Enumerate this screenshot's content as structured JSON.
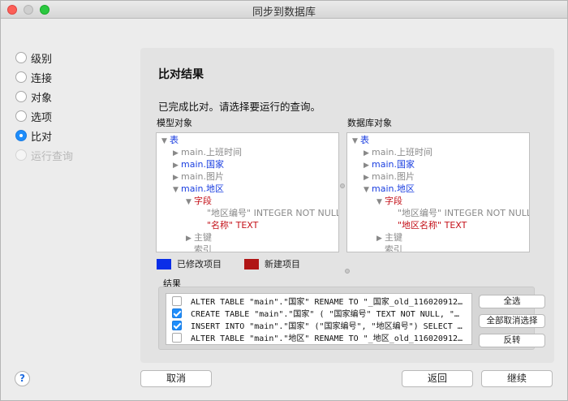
{
  "window": {
    "title": "同步到数据库"
  },
  "steps": [
    {
      "label": "级别",
      "selected": false,
      "disabled": false
    },
    {
      "label": "连接",
      "selected": false,
      "disabled": false
    },
    {
      "label": "对象",
      "selected": false,
      "disabled": false
    },
    {
      "label": "选项",
      "selected": false,
      "disabled": false
    },
    {
      "label": "比对",
      "selected": true,
      "disabled": false
    },
    {
      "label": "运行查询",
      "selected": false,
      "disabled": true
    }
  ],
  "panel": {
    "title": "比对结果",
    "description": "已完成比对。请选择要运行的查询。"
  },
  "model_tree": {
    "label": "模型对象",
    "rows": [
      {
        "text": "表"
      },
      {
        "text": "main.上班时间"
      },
      {
        "text": "main.国家"
      },
      {
        "text": "main.图片"
      },
      {
        "text": "main.地区"
      },
      {
        "text": "字段"
      },
      {
        "text": "\"地区编号\" INTEGER NOT NULL"
      },
      {
        "text": "\"名称\" TEXT"
      },
      {
        "text": "主键"
      },
      {
        "text": "索引"
      }
    ]
  },
  "db_tree": {
    "label": "数据库对象",
    "rows": [
      {
        "text": "表"
      },
      {
        "text": "main.上班时间"
      },
      {
        "text": "main.国家"
      },
      {
        "text": "main.图片"
      },
      {
        "text": "main.地区"
      },
      {
        "text": "字段"
      },
      {
        "text": "\"地区编号\" INTEGER NOT NULL"
      },
      {
        "text": "\"地区名称\" TEXT"
      },
      {
        "text": "主键"
      },
      {
        "text": "索引"
      }
    ]
  },
  "legend": {
    "modified": {
      "label": "已修改项目",
      "color": "#0a2ee8"
    },
    "new": {
      "label": "新建项目",
      "color": "#b01515"
    }
  },
  "results": {
    "label": "结果",
    "rows": [
      {
        "checked": false,
        "text": "ALTER TABLE \"main\".\"国家\" RENAME TO \"_国家_old_1160209122..."
      },
      {
        "checked": true,
        "text": "CREATE TABLE \"main\".\"国家\" ( \"国家编号\" TEXT NOT NULL, \"名..."
      },
      {
        "checked": true,
        "text": "INSERT INTO \"main\".\"国家\" (\"国家编号\", \"地区编号\") SELECT \"国..."
      },
      {
        "checked": false,
        "text": "ALTER TABLE \"main\".\"地区\" RENAME TO \"_地区_old_1160209122..."
      }
    ],
    "buttons": {
      "select_all": "全选",
      "deselect_all": "全部取消选择",
      "invert": "反转"
    }
  },
  "footer": {
    "help": "?",
    "cancel": "取消",
    "back": "返回",
    "continue": "继续"
  },
  "colors": {
    "accent": "#1e8dfb",
    "modified": "#1a3ee0",
    "new": "#c4121a"
  }
}
